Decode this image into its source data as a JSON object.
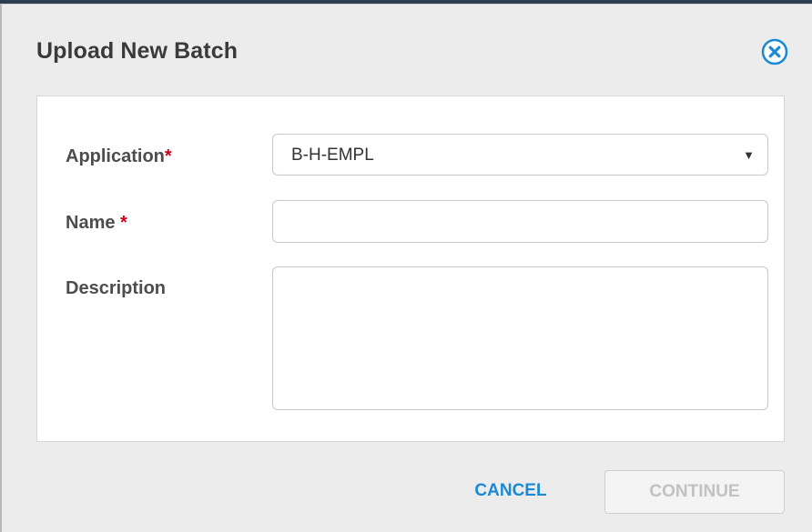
{
  "dialog": {
    "title": "Upload New Batch",
    "close_icon": "close-circle-icon"
  },
  "form": {
    "application": {
      "label": "Application",
      "required_mark": "*",
      "selected_value": "B-H-EMPL",
      "dropdown_icon": "triangle-down-icon"
    },
    "name": {
      "label": "Name ",
      "required_mark": "*",
      "value": ""
    },
    "description": {
      "label": "Description",
      "value": ""
    }
  },
  "actions": {
    "cancel_label": "CANCEL",
    "continue_label": "CONTINUE",
    "continue_disabled": true
  },
  "colors": {
    "accent": "#1a8ad4",
    "required": "#d0021b",
    "dialog_bg": "#ececec",
    "disabled_text": "#c2c2c2"
  }
}
